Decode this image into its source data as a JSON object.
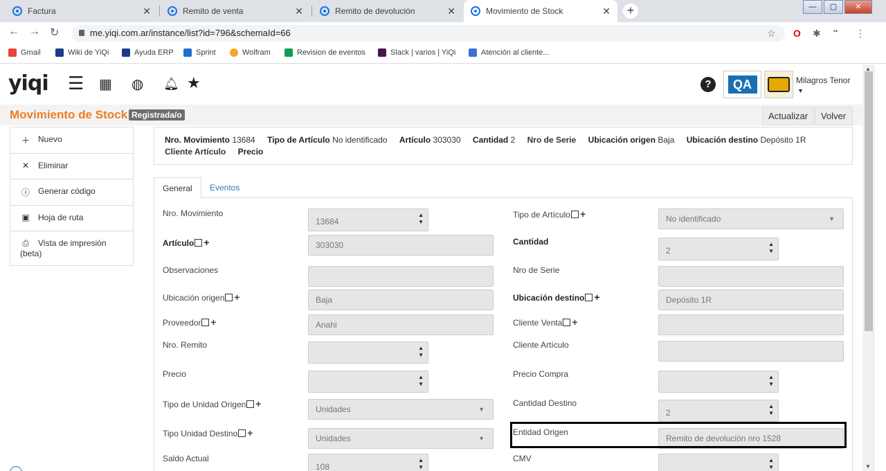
{
  "browser": {
    "tabs": [
      {
        "title": "Factura"
      },
      {
        "title": "Remito de venta"
      },
      {
        "title": "Remito de devolución"
      },
      {
        "title": "Movimiento de Stock"
      }
    ],
    "url": "me.yiqi.com.ar/instance/list?id=796&schemaId=66",
    "bookmarks": [
      "Gmail",
      "Wiki de YiQi",
      "Ayuda ERP",
      "Sprint",
      "Wolfram",
      "Revision de eventos",
      "Slack | varios | YiQi",
      "Atención al cliente..."
    ]
  },
  "header": {
    "logo": "yiqi",
    "qa_label": "QA",
    "user_name": "Milagros Tenor"
  },
  "page": {
    "title": "Movimiento de Stock",
    "status_badge": "Registrada/o",
    "actualizar": "Actualizar",
    "volver": "Volver"
  },
  "sidebar": {
    "items": [
      {
        "label": "Nuevo",
        "icon": "plus-icon"
      },
      {
        "label": "Eliminar",
        "icon": "x-icon"
      },
      {
        "label": "Generar código",
        "icon": "info-icon"
      },
      {
        "label": "Hoja de ruta",
        "icon": "calendar-icon"
      },
      {
        "label": "Vista de impresión (beta)",
        "icon": "printer-icon"
      }
    ]
  },
  "summary": {
    "nro_label": "Nro. Movimiento",
    "nro": "13684",
    "tipo_label": "Tipo de Artículo",
    "tipo": "No identificado",
    "articulo_label": "Artículo",
    "articulo": "303030",
    "cantidad_label": "Cantidad",
    "cantidad": "2",
    "serie_label": "Nro de Serie",
    "origen_label": "Ubicación origen",
    "origen": "Baja",
    "destino_label": "Ubicación destino",
    "destino": "Depósito 1R",
    "cliente_label": "Cliente Artículo",
    "precio_label": "Precio"
  },
  "tabs": {
    "general": "General",
    "eventos": "Eventos"
  },
  "form": {
    "nro_movimiento": {
      "label": "Nro. Movimiento",
      "value": "13684"
    },
    "tipo_articulo": {
      "label": "Tipo de Artículo",
      "value": "No identificado"
    },
    "articulo": {
      "label": "Artículo",
      "value": "303030"
    },
    "cantidad": {
      "label": "Cantidad",
      "value": "2"
    },
    "observaciones": {
      "label": "Observaciones",
      "value": ""
    },
    "nro_serie": {
      "label": "Nro de Serie",
      "value": ""
    },
    "ubicacion_origen": {
      "label": "Ubicación origen",
      "value": "Baja"
    },
    "ubicacion_destino": {
      "label": "Ubicación destino",
      "value": "Depósito 1R"
    },
    "proveedor": {
      "label": "Proveedor",
      "value": "Anahi"
    },
    "cliente_venta": {
      "label": "Cliente Venta",
      "value": ""
    },
    "nro_remito": {
      "label": "Nro. Remito",
      "value": ""
    },
    "cliente_articulo": {
      "label": "Cliente Artículo",
      "value": ""
    },
    "precio": {
      "label": "Precio",
      "value": ""
    },
    "precio_compra": {
      "label": "Precio Compra",
      "value": ""
    },
    "tipo_unidad_origen": {
      "label": "Tipo de Unidad Origen",
      "value": "Unidades"
    },
    "cantidad_destino": {
      "label": "Cantidad Destino",
      "value": "2"
    },
    "tipo_unidad_destino": {
      "label": "Tipo Unidad Destino",
      "value": "Unidades"
    },
    "entidad_origen": {
      "label": "Entidad Origen",
      "value": "Remito de devolución nro 1528"
    },
    "saldo_actual": {
      "label": "Saldo Actual",
      "value": "108"
    },
    "cmv": {
      "label": "CMV",
      "value": ""
    }
  }
}
